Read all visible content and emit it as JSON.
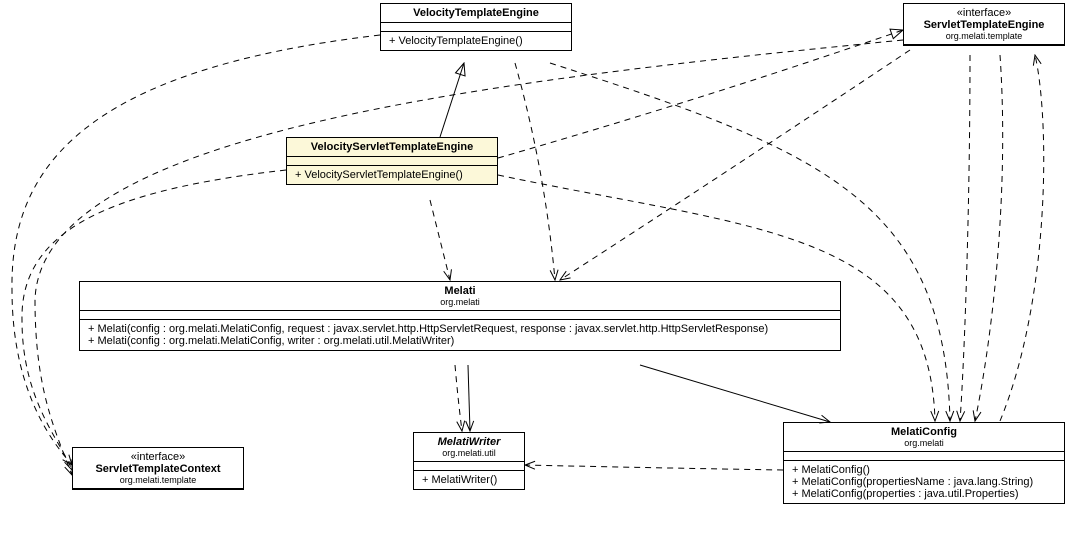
{
  "uml": {
    "velocityTemplateEngine": {
      "name": "VelocityTemplateEngine",
      "constructor": "+ VelocityTemplateEngine()"
    },
    "servletTemplateEngine": {
      "stereotype": "«interface»",
      "name": "ServletTemplateEngine",
      "package": "org.melati.template"
    },
    "velocityServletTemplateEngine": {
      "name": "VelocityServletTemplateEngine",
      "constructor": "+ VelocityServletTemplateEngine()"
    },
    "melati": {
      "name": "Melati",
      "package": "org.melati",
      "constructor1": "+ Melati(config : org.melati.MelatiConfig, request : javax.servlet.http.HttpServletRequest, response : javax.servlet.http.HttpServletResponse)",
      "constructor2": "+ Melati(config : org.melati.MelatiConfig, writer : org.melati.util.MelatiWriter)"
    },
    "servletTemplateContext": {
      "stereotype": "«interface»",
      "name": "ServletTemplateContext",
      "package": "org.melati.template"
    },
    "melatiWriter": {
      "name": "MelatiWriter",
      "package": "org.melati.util",
      "constructor": "+ MelatiWriter()"
    },
    "melatiConfig": {
      "name": "MelatiConfig",
      "package": "org.melati",
      "constructor1": "+ MelatiConfig()",
      "constructor2": "+ MelatiConfig(propertiesName : java.lang.String)",
      "constructor3": "+ MelatiConfig(properties : java.util.Properties)"
    }
  }
}
